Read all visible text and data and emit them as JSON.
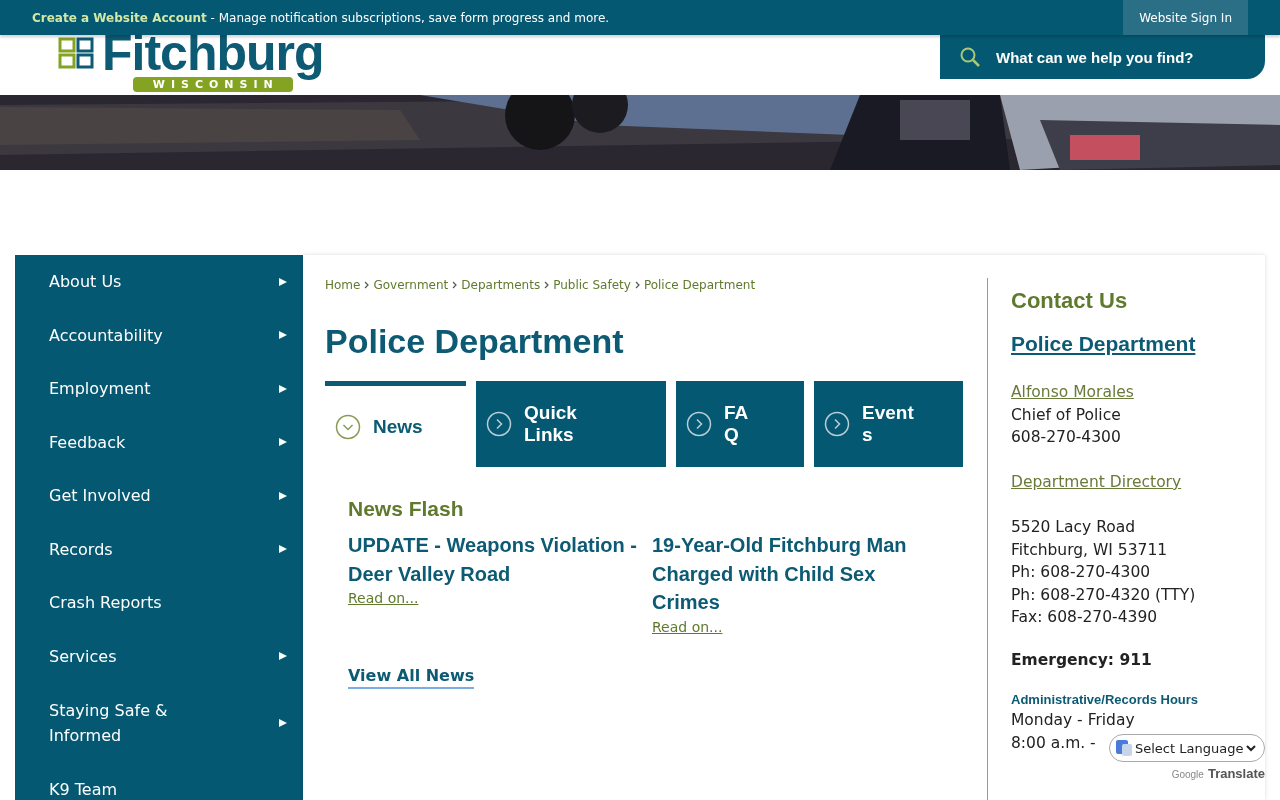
{
  "top_bar": {
    "account_link": "Create a Website Account",
    "account_text": " - Manage notification subscriptions, save form progress and more.",
    "sign_in": "Website Sign In"
  },
  "header": {
    "logo_name": "Fitchburg",
    "logo_state": "WISCONSIN",
    "search": {
      "placeholder": "What can we help you find?"
    }
  },
  "sidebar": {
    "items": [
      {
        "label": "About Us",
        "has_submenu": true
      },
      {
        "label": "Accountability",
        "has_submenu": true
      },
      {
        "label": "Employment",
        "has_submenu": true
      },
      {
        "label": "Feedback",
        "has_submenu": true
      },
      {
        "label": "Get Involved",
        "has_submenu": true
      },
      {
        "label": "Records",
        "has_submenu": true
      },
      {
        "label": "Crash Reports",
        "has_submenu": false
      },
      {
        "label": "Services",
        "has_submenu": true
      },
      {
        "label": "Staying Safe & Informed",
        "has_submenu": true
      },
      {
        "label": "K9 Team",
        "has_submenu": false
      }
    ]
  },
  "breadcrumb": [
    "Home",
    "Government",
    "Departments",
    "Public Safety",
    "Police Department"
  ],
  "title": "Police Department",
  "tabs": [
    {
      "label": "News",
      "selected": true
    },
    {
      "label": "Quick Links",
      "selected": false
    },
    {
      "label": "FAQ",
      "selected": false
    },
    {
      "label": "Events",
      "selected": false
    }
  ],
  "news_flash": {
    "heading": "News Flash",
    "items": [
      {
        "title": "UPDATE - Weapons Violation - Deer Valley Road",
        "link": "Read on..."
      },
      {
        "title": "19-Year-Old Fitchburg Man Charged with Child Sex Crimes",
        "link": "Read on..."
      }
    ],
    "view_all": "View All News"
  },
  "contact": {
    "heading": "Contact Us",
    "department": "Police Department",
    "person": "Alfonso Morales",
    "role": "Chief of Police",
    "person_phone": "608-270-4300",
    "directory": "Department Directory",
    "address_lines": [
      "5520 Lacy Road",
      "Fitchburg, WI 53711",
      "Ph: 608-270-4300",
      "Ph: 608-270-4320 (TTY)",
      "Fax: 608-270-4390"
    ],
    "emergency": "Emergency: 911",
    "hours_heading": "Administrative/Records Hours",
    "hours_lines": [
      "Monday - Friday",
      "8:00 a.m. -"
    ]
  },
  "translate": {
    "select": "Select Language",
    "powered_by": "Google",
    "brand": "Translate"
  }
}
